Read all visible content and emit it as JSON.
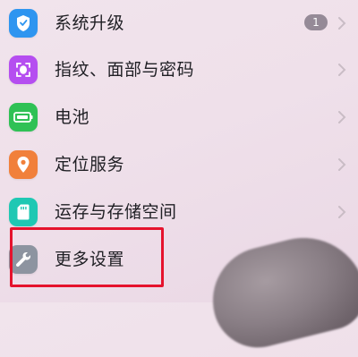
{
  "settings": {
    "items": [
      {
        "label": "系统升级",
        "icon": "shield-icon",
        "color": "#2e95f0",
        "badge": "1"
      },
      {
        "label": "指纹、面部与密码",
        "icon": "face-unlock-icon",
        "color": "#b54ef0"
      },
      {
        "label": "电池",
        "icon": "battery-icon",
        "color": "#2fc155"
      },
      {
        "label": "定位服务",
        "icon": "location-pin-icon",
        "color": "#f1803b"
      },
      {
        "label": "运存与存储空间",
        "icon": "storage-icon",
        "color": "#1fc8b3"
      },
      {
        "label": "更多设置",
        "icon": "wrench-icon",
        "color": "#8d94a0"
      }
    ]
  },
  "annotation": {
    "highlight_color": "#e5132d",
    "highlighted_item": "更多设置"
  }
}
